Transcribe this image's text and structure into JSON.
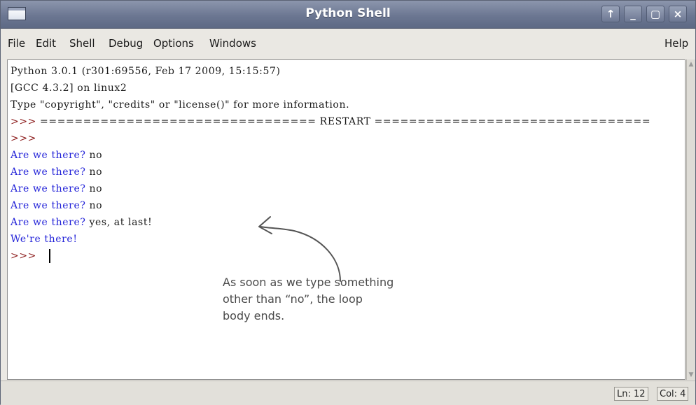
{
  "window": {
    "title": "Python Shell",
    "buttons": [
      "↑",
      "_",
      "▢",
      "×"
    ]
  },
  "menubar": {
    "items": [
      {
        "label": "File"
      },
      {
        "label": "Edit"
      },
      {
        "label": "Shell"
      },
      {
        "label": "Debug"
      },
      {
        "label": "Options"
      },
      {
        "label": "Windows"
      }
    ],
    "help": "Help"
  },
  "shell": {
    "line1": "Python 3.0.1 (r301:69556, Feb 17 2009, 15:15:57)",
    "line2": "[GCC 4.3.2] on linux2",
    "line3": "Type \"copyright\", \"credits\" or \"license()\" for more information.",
    "restart_prompt": ">>> ",
    "restart_text": "================================ RESTART ================================",
    "prompt2": ">>>",
    "q1": "Are we there? ",
    "a1": "no",
    "q2": "Are we there? ",
    "a2": "no",
    "q3": "Are we there? ",
    "a3": "no",
    "q4": "Are we there? ",
    "a4": "no",
    "q5": "Are we there? ",
    "a5": "yes, at last!",
    "done": "We're there!",
    "prompt3": ">>> "
  },
  "annotation": {
    "line1": "As soon as we type something",
    "line2": "other than “no”, the loop",
    "line3": "body ends."
  },
  "status": {
    "line": "Ln: 12",
    "col": "Col: 4"
  },
  "colors": {
    "prompt": "#8b1a1a",
    "user_output": "#2222d8",
    "titlebar": "#6c7792"
  }
}
